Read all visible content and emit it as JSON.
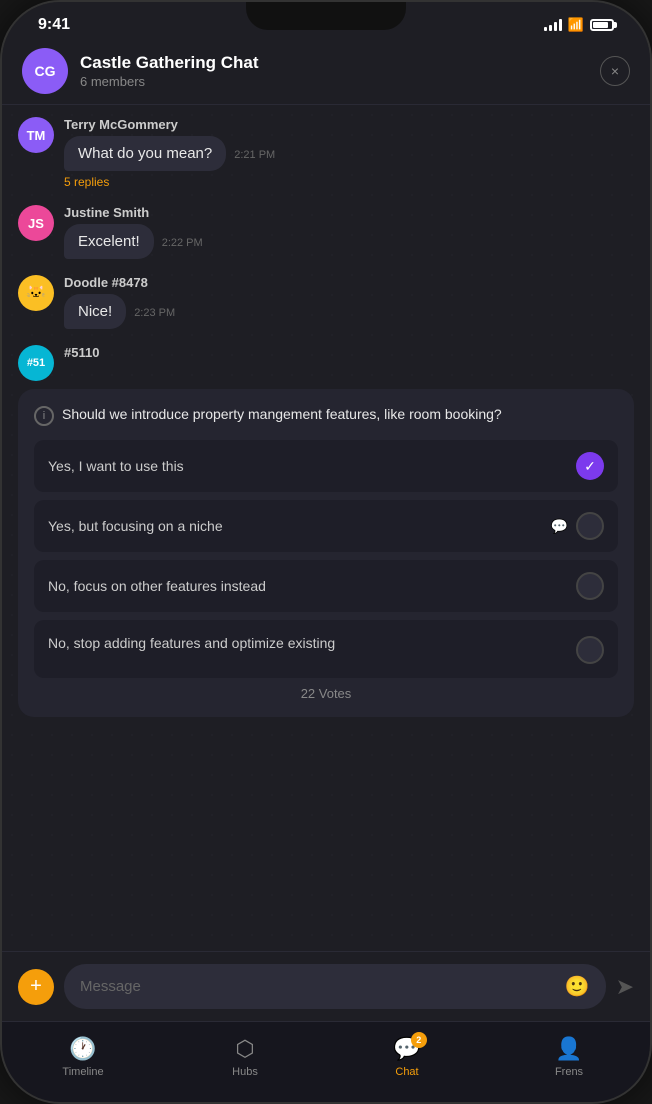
{
  "status": {
    "time": "9:41",
    "battery": "75"
  },
  "header": {
    "avatar_initials": "CG",
    "title": "Castle Gathering Chat",
    "subtitle": "6 members",
    "close_label": "×"
  },
  "messages": [
    {
      "id": "msg-1",
      "sender": "Terry McGommery",
      "avatar_initials": "TM",
      "text": "What do you mean?",
      "time": "2:21 PM",
      "replies": "5 replies"
    },
    {
      "id": "msg-2",
      "sender": "Justine Smith",
      "avatar_initials": "JS",
      "text": "Excelent!",
      "time": "2:22 PM",
      "replies": null
    },
    {
      "id": "msg-3",
      "sender": "Doodle #8478",
      "avatar_initials": "🐱",
      "text": "Nice!",
      "time": "2:23 PM",
      "replies": null
    },
    {
      "id": "msg-4",
      "sender": "#5110",
      "avatar_initials": "#51"
    }
  ],
  "poll": {
    "question": "Should we introduce property mangement features, like room booking?",
    "options": [
      {
        "id": "opt-1",
        "text": "Yes, I want to use this",
        "state": "checked"
      },
      {
        "id": "opt-2",
        "text": "Yes, but focusing on a niche",
        "state": "comment"
      },
      {
        "id": "opt-3",
        "text": "No, focus on other features instead",
        "state": "radio"
      },
      {
        "id": "opt-4",
        "text": "No, stop adding features and optimize existing",
        "state": "radio"
      }
    ],
    "votes": "22 Votes"
  },
  "input": {
    "placeholder": "Message",
    "add_icon": "+",
    "emoji": "🙂"
  },
  "nav": {
    "items": [
      {
        "id": "timeline",
        "label": "Timeline",
        "icon": "🕐",
        "active": false,
        "badge": null
      },
      {
        "id": "hubs",
        "label": "Hubs",
        "icon": "⬡",
        "active": false,
        "badge": null
      },
      {
        "id": "chat",
        "label": "Chat",
        "icon": "💬",
        "active": true,
        "badge": "2"
      },
      {
        "id": "frens",
        "label": "Frens",
        "icon": "👤",
        "active": false,
        "badge": null
      }
    ]
  }
}
